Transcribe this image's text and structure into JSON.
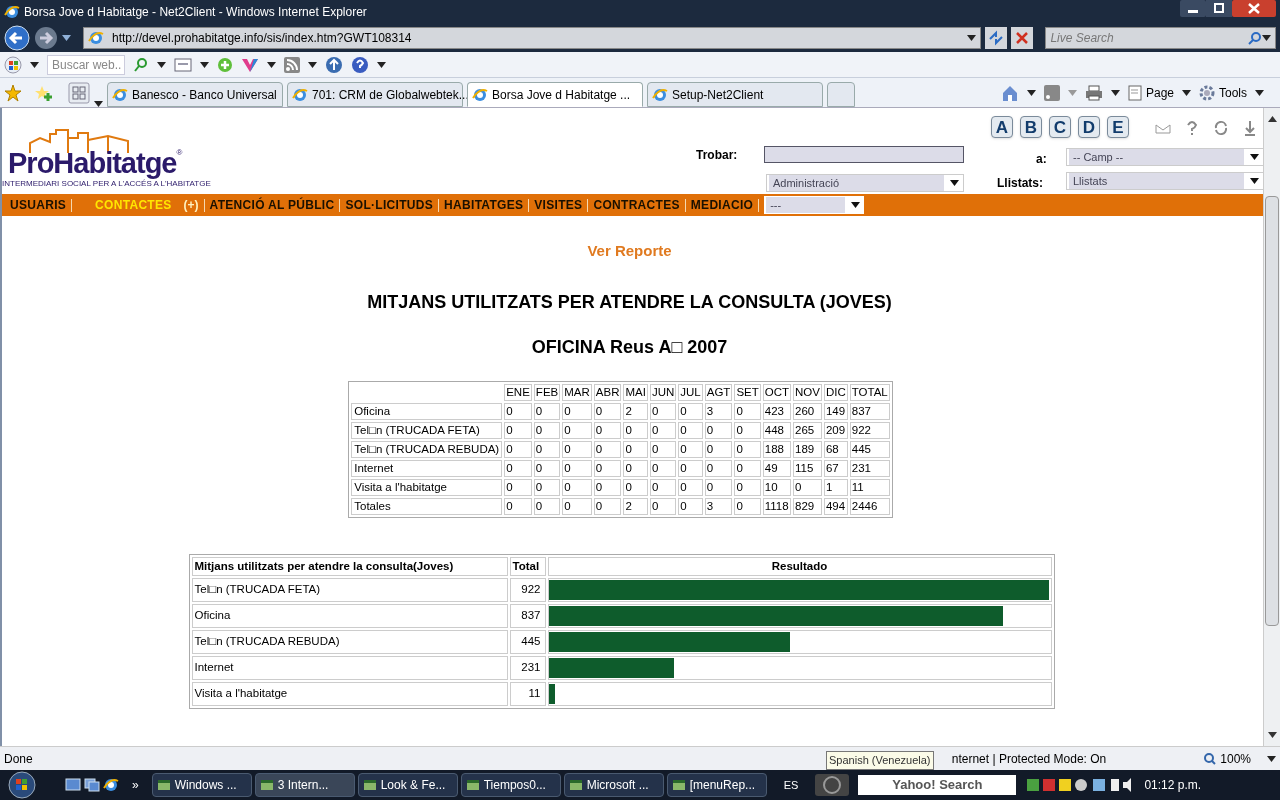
{
  "window": {
    "title": "Borsa Jove d Habitatge - Net2Client - Windows Internet Explorer"
  },
  "address_bar": {
    "url": "http://devel.prohabitatge.info/sis/index.htm?GWT108314"
  },
  "live_search": {
    "placeholder": "Live Search"
  },
  "toolbar_search": {
    "placeholder": "Buscar web.."
  },
  "tabs": [
    {
      "label": "Banesco - Banco Universal",
      "selected": false
    },
    {
      "label": "701: CRM de Globalwebtek...",
      "selected": false
    },
    {
      "label": "Borsa Jove d Habitatge ...",
      "selected": true
    },
    {
      "label": "Setup-Net2Client",
      "selected": false
    }
  ],
  "command_bar": [
    "Page",
    "Tools"
  ],
  "site": {
    "logo": "ProHabitatge",
    "logo_mark": "®",
    "tagline": "INTERMEDIARI SOCIAL PER A L'ACCÉS A L'HABITATGE",
    "letter_buttons": [
      "A",
      "B",
      "C",
      "D",
      "E"
    ],
    "find_label": "Trobar:",
    "field_label": "a:",
    "field_select": "-- Camp --",
    "area_select": "Administració",
    "lists_label": "Llistats:",
    "lists_select": "Llistats"
  },
  "menu": [
    {
      "label": "USUARIS",
      "selected": false
    },
    {
      "label": "CONTACTES",
      "selected": true,
      "extra": "(+)"
    },
    {
      "label": "ATENCIÓ AL PÚBLIC",
      "selected": false
    },
    {
      "label": "SOL·LICITUDS",
      "selected": false
    },
    {
      "label": "HABITATGES",
      "selected": false
    },
    {
      "label": "VISITES",
      "selected": false
    },
    {
      "label": "CONTRACTES",
      "selected": false
    },
    {
      "label": "MEDIACIO",
      "selected": false
    }
  ],
  "menu_select": "---",
  "report": {
    "link": "Ver Reporte",
    "title": "MITJANS UTILITZATS PER ATENDRE LA CONSULTA (JOVES)",
    "subtitle": "OFICINA Reus A□ 2007"
  },
  "monthly_table": {
    "columns": [
      "ENE",
      "FEB",
      "MAR",
      "ABR",
      "MAI",
      "JUN",
      "JUL",
      "AGT",
      "SET",
      "OCT",
      "NOV",
      "DIC",
      "TOTAL"
    ],
    "rows": [
      {
        "label": "Oficina",
        "values": [
          "0",
          "0",
          "0",
          "0",
          "2",
          "0",
          "0",
          "3",
          "0",
          "423",
          "260",
          "149",
          "837"
        ]
      },
      {
        "label": "Tel□n (TRUCADA FETA)",
        "values": [
          "0",
          "0",
          "0",
          "0",
          "0",
          "0",
          "0",
          "0",
          "0",
          "448",
          "265",
          "209",
          "922"
        ]
      },
      {
        "label": "Tel□n (TRUCADA REBUDA)",
        "values": [
          "0",
          "0",
          "0",
          "0",
          "0",
          "0",
          "0",
          "0",
          "0",
          "188",
          "189",
          "68",
          "445"
        ]
      },
      {
        "label": "Internet",
        "values": [
          "0",
          "0",
          "0",
          "0",
          "0",
          "0",
          "0",
          "0",
          "0",
          "49",
          "115",
          "67",
          "231"
        ]
      },
      {
        "label": "Visita a l'habitatge",
        "values": [
          "0",
          "0",
          "0",
          "0",
          "0",
          "0",
          "0",
          "0",
          "0",
          "10",
          "0",
          "1",
          "11"
        ]
      },
      {
        "label": "Totales",
        "values": [
          "0",
          "0",
          "0",
          "0",
          "2",
          "0",
          "0",
          "3",
          "0",
          "1118",
          "829",
          "494",
          "2446"
        ]
      }
    ]
  },
  "result_table": {
    "columns": [
      "Mitjans utilitzats per atendre la consulta(Joves)",
      "Total",
      "Resultado"
    ],
    "rows": [
      {
        "label": "Tel□n (TRUCADA FETA)",
        "total": "922",
        "level": 1
      },
      {
        "label": "Oficina",
        "total": "837",
        "level": 0.908
      },
      {
        "label": "Tel□n (TRUCADA REBUDA)",
        "total": "445",
        "level": 0.483
      },
      {
        "label": "Internet",
        "total": "231",
        "level": 0.251
      },
      {
        "label": "Visita a l'habitatge",
        "total": "11",
        "level": 0.012
      }
    ]
  },
  "status_bar": {
    "text": "Done",
    "zone": "nternet | Protected Mode: On",
    "zoom": "100%",
    "tooltip": "Spanish (Venezuela)"
  },
  "taskbar": {
    "more": "»",
    "items": [
      {
        "label": "Windows ...",
        "selected": false
      },
      {
        "label": "3 Intern...",
        "selected": true
      },
      {
        "label": "Look & Fe...",
        "selected": false
      },
      {
        "label": "Tiempos0...",
        "selected": false
      },
      {
        "label": "Microsoft ...",
        "selected": false
      },
      {
        "label": "[menuRep...",
        "selected": false
      }
    ],
    "language": "ES",
    "search": "Yahoo! Search",
    "clock": "01:12 p.m."
  }
}
